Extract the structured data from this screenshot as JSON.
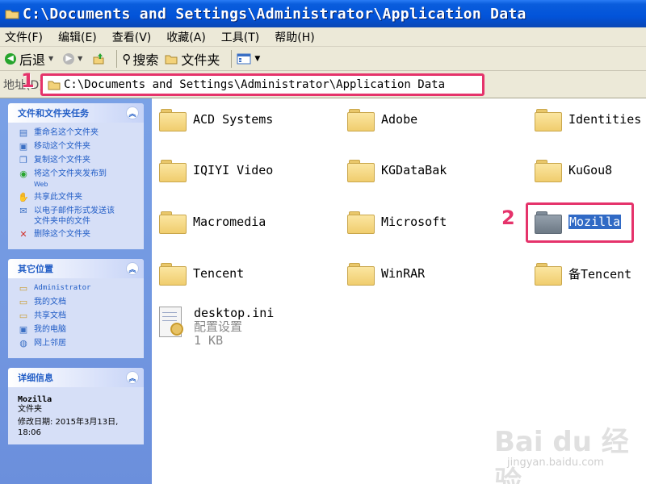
{
  "window": {
    "title": "C:\\Documents and Settings\\Administrator\\Application Data"
  },
  "menu": [
    "文件(F)",
    "编辑(E)",
    "查看(V)",
    "收藏(A)",
    "工具(T)",
    "帮助(H)"
  ],
  "toolbar": {
    "back_label": "后退",
    "search_label": "搜索",
    "folders_label": "文件夹"
  },
  "address": {
    "label": "地址(D)",
    "value": "C:\\Documents and Settings\\Administrator\\Application Data"
  },
  "callouts": {
    "one": "1",
    "two": "2"
  },
  "sidebar": {
    "tasks": {
      "title": "文件和文件夹任务",
      "items": [
        {
          "label": "重命名这个文件夹",
          "icon": "rename-icon"
        },
        {
          "label": "移动这个文件夹",
          "icon": "move-icon"
        },
        {
          "label": "复制这个文件夹",
          "icon": "copy-icon"
        },
        {
          "label": "将这个文件夹发布到",
          "label2": "Web",
          "icon": "publish-web-icon"
        },
        {
          "label": "共享此文件夹",
          "icon": "share-icon"
        },
        {
          "label": "以电子邮件形式发送该",
          "label2": "文件夹中的文件",
          "icon": "email-icon"
        },
        {
          "label": "删除这个文件夹",
          "icon": "delete-icon"
        }
      ]
    },
    "places": {
      "title": "其它位置",
      "items": [
        {
          "label": "Administrator",
          "icon": "folder-icon"
        },
        {
          "label": "我的文档",
          "icon": "my-documents-icon"
        },
        {
          "label": "共享文档",
          "icon": "shared-docs-icon"
        },
        {
          "label": "我的电脑",
          "icon": "my-computer-icon"
        },
        {
          "label": "网上邻居",
          "icon": "network-icon"
        }
      ]
    },
    "details": {
      "title": "详细信息",
      "name": "Mozilla",
      "type": "文件夹",
      "modified": "修改日期: 2015年3月13日,",
      "time": "18:06"
    }
  },
  "files": [
    {
      "name": "ACD Systems"
    },
    {
      "name": "Adobe"
    },
    {
      "name": "Identities"
    },
    {
      "name": "IQIYI Video"
    },
    {
      "name": "KGDataBak"
    },
    {
      "name": "KuGou8"
    },
    {
      "name": "Macromedia"
    },
    {
      "name": "Microsoft"
    },
    {
      "name": "Mozilla"
    },
    {
      "name": "Tencent"
    },
    {
      "name": "WinRAR"
    },
    {
      "name": "备Tencent"
    }
  ],
  "file_ini": {
    "name": "desktop.ini",
    "type": "配置设置",
    "size": "1 KB"
  },
  "watermark": {
    "brand": "Bai du 经验",
    "url": "jingyan.baidu.com"
  },
  "colors": {
    "highlight": "#e5336b",
    "selection": "#316ac5",
    "titlebar": "#0253d9"
  }
}
